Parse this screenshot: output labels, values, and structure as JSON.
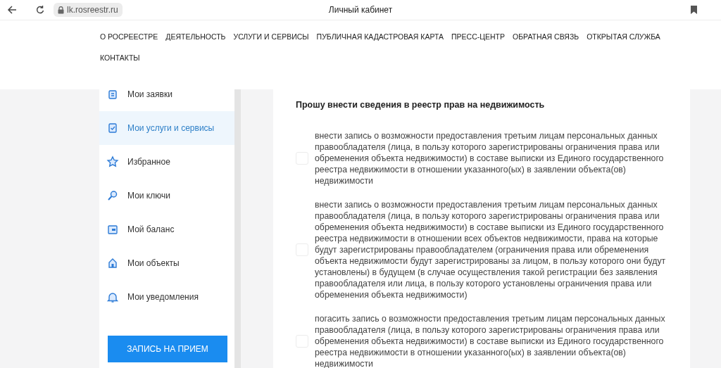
{
  "browser": {
    "url": "lk.rosreestr.ru",
    "title": "Личный кабинет"
  },
  "nav": [
    "О РОСРЕЕСТРЕ",
    "ДЕЯТЕЛЬНОСТЬ",
    "УСЛУГИ И СЕРВИСЫ",
    "ПУБЛИЧНАЯ КАДАСТРОВАЯ КАРТА",
    "ПРЕСС-ЦЕНТР",
    "ОБРАТНАЯ СВЯЗЬ",
    "ОТКРЫТАЯ СЛУЖБА",
    "КОНТАКТЫ"
  ],
  "sidebar": {
    "items": [
      {
        "kind": "requests",
        "label": "Мои заявки",
        "selected": false
      },
      {
        "kind": "services",
        "label": "Мои услуги и сервисы",
        "selected": true
      },
      {
        "kind": "favorites",
        "label": "Избранное",
        "selected": false
      },
      {
        "kind": "keys",
        "label": "Мои ключи",
        "selected": false
      },
      {
        "kind": "balance",
        "label": "Мой баланс",
        "selected": false
      },
      {
        "kind": "objects",
        "label": "Мои объекты",
        "selected": false
      },
      {
        "kind": "notifications",
        "label": "Мои уведомления",
        "selected": false
      }
    ],
    "button": "ЗАПИСЬ НА ПРИЕМ"
  },
  "form": {
    "heading": "Прошу внести сведения в реестр прав на недвижимость",
    "options": [
      {
        "checked": false,
        "text": "внести запись о возможности предоставления третьим лицам персональных данных правообладателя (лица, в пользу которого зарегистрированы ограничения права или обременения объекта недвижимости) в составе выписки из Единого государственного реестра недвижимости в отношении указанного(ых) в заявлении объекта(ов) недвижимости"
      },
      {
        "checked": false,
        "text": "внести запись о возможности предоставления третьим лицам персональных данных правообладателя (лица, в пользу которого зарегистрированы ограничения права или обременения объекта недвижимости) в составе выписки из Единого государственного реестра недвижимости в отношении всех объектов недвижимости, права на которые будут зарегистрированы правообладателем (ограничения права или обременения объекта недвижимости будут зарегистрированы за лицом, в пользу которого они будут установлены) в будущем (в случае осуществления такой регистрации без заявления правообладателя или лица, в пользу которого установлены ограничения права или обременения объекта недвижимости)"
      },
      {
        "checked": false,
        "text": "погасить запись о возможности предоставления третьим лицам персональных данных правообладателя (лица, в пользу которого зарегистрированы ограничения права или обременения объекта недвижимости) в составе выписки из Единого государственного реестра недвижимости в отношении указанного(ых) в заявлении объекта(ов) недвижимости"
      }
    ]
  }
}
